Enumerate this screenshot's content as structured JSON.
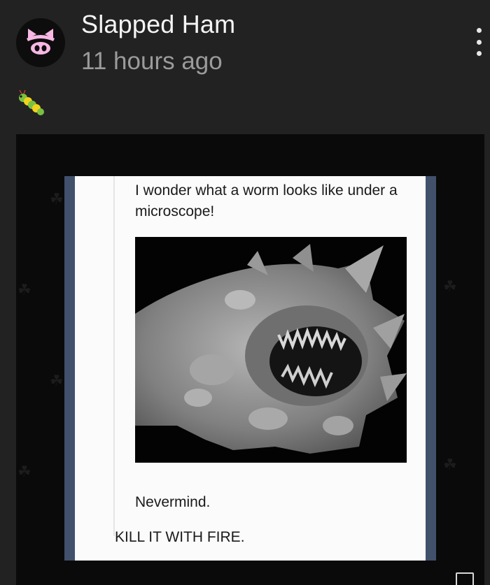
{
  "post": {
    "author": "Slapped Ham",
    "timestamp": "11 hours ago",
    "avatar_icon": "pig-face-icon",
    "menu_icon": "more-vertical-icon",
    "emoji_icon": "caterpillar-emoji-icon"
  },
  "meme": {
    "quote": "I wonder what a worm looks like under a microscope!",
    "reply_1": "Nevermind.",
    "reply_2": "KILL IT WITH FIRE."
  },
  "colors": {
    "background": "#222222",
    "avatar_pig": "#f7b8e4",
    "tumblr_blue": "#41506b"
  }
}
